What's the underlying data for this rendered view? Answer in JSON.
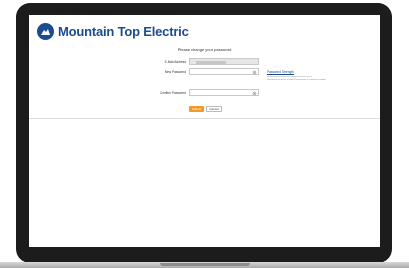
{
  "brand": {
    "name": "Mountain Top Electric"
  },
  "form": {
    "instruction": "Please change your password",
    "email_label": "E-Mail Address",
    "new_password_label": "New Password",
    "confirm_password_label": "Confirm Password",
    "requirements_link": "Password Strength",
    "requirements_note": "Passwords must be at least 8 characters & contain a number",
    "submit_label": "Submit",
    "cancel_label": "Cancel"
  },
  "colors": {
    "brand": "#1a4d8f",
    "accent": "#f39a2a"
  },
  "icons": {
    "logo": "mountain-logo-icon",
    "field": "eye-icon"
  }
}
